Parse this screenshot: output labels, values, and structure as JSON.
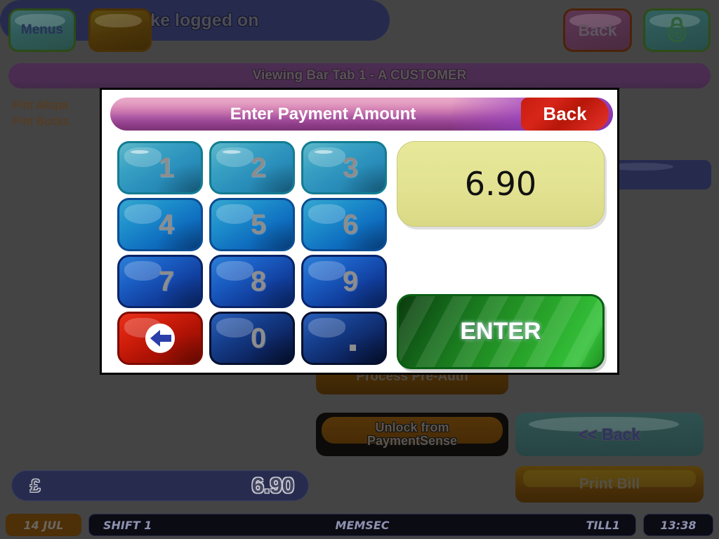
{
  "topbar": {
    "menus_label": "Menus",
    "blank_label": "",
    "status_label": "Mike logged on",
    "back_label": "Back",
    "lock_icon": "padlock-icon"
  },
  "tab_title": "Viewing Bar Tab 1 - A CUSTOMER",
  "order_list": {
    "items": [
      "Pint Allspa",
      "Pint Bucks"
    ]
  },
  "background_buttons": {
    "process_preauth": "Process Pre-Auth",
    "unlock_line1": "Unlock from",
    "unlock_line2": "PaymentSense",
    "back": "<< Back",
    "print_bill": "Print Bill"
  },
  "total_bar": {
    "currency": "£",
    "amount": "6.90"
  },
  "status_bar": {
    "date": "14 JUL",
    "shift": "SHIFT 1",
    "operator": "MEMSEC",
    "till": "TILL1",
    "time": "13:38"
  },
  "dialog": {
    "title": "Enter Payment Amount",
    "back_label": "Back",
    "display_value": "6.90",
    "enter_label": "ENTER",
    "keys": [
      {
        "label": "1",
        "name": "key-1",
        "kind": "num",
        "row": 1
      },
      {
        "label": "2",
        "name": "key-2",
        "kind": "num",
        "row": 1
      },
      {
        "label": "3",
        "name": "key-3",
        "kind": "num",
        "row": 1
      },
      {
        "label": "4",
        "name": "key-4",
        "kind": "num",
        "row": 2
      },
      {
        "label": "5",
        "name": "key-5",
        "kind": "num",
        "row": 2
      },
      {
        "label": "6",
        "name": "key-6",
        "kind": "num",
        "row": 2
      },
      {
        "label": "7",
        "name": "key-7",
        "kind": "num",
        "row": 3
      },
      {
        "label": "8",
        "name": "key-8",
        "kind": "num",
        "row": 3
      },
      {
        "label": "9",
        "name": "key-9",
        "kind": "num",
        "row": 3
      },
      {
        "label": "",
        "name": "key-backspace",
        "kind": "backspace",
        "row": 4
      },
      {
        "label": "0",
        "name": "key-0",
        "kind": "num",
        "row": 4
      },
      {
        "label": ".",
        "name": "key-decimal",
        "kind": "dot",
        "row": 4
      }
    ]
  },
  "colors": {
    "screen_background": "#444444",
    "dialog_background": "#ffffff",
    "dialog_border": "#000000",
    "header_gradient_start": "#e9a9c8",
    "header_gradient_end": "#7c3273",
    "back_red": "#c71d10",
    "display_yellow": "#e8e89a",
    "enter_green": "#2aa82c",
    "keypad_blue": "#1e8ecb",
    "status_navy": "#262b4e",
    "tab_purple": "#4b2d52"
  }
}
